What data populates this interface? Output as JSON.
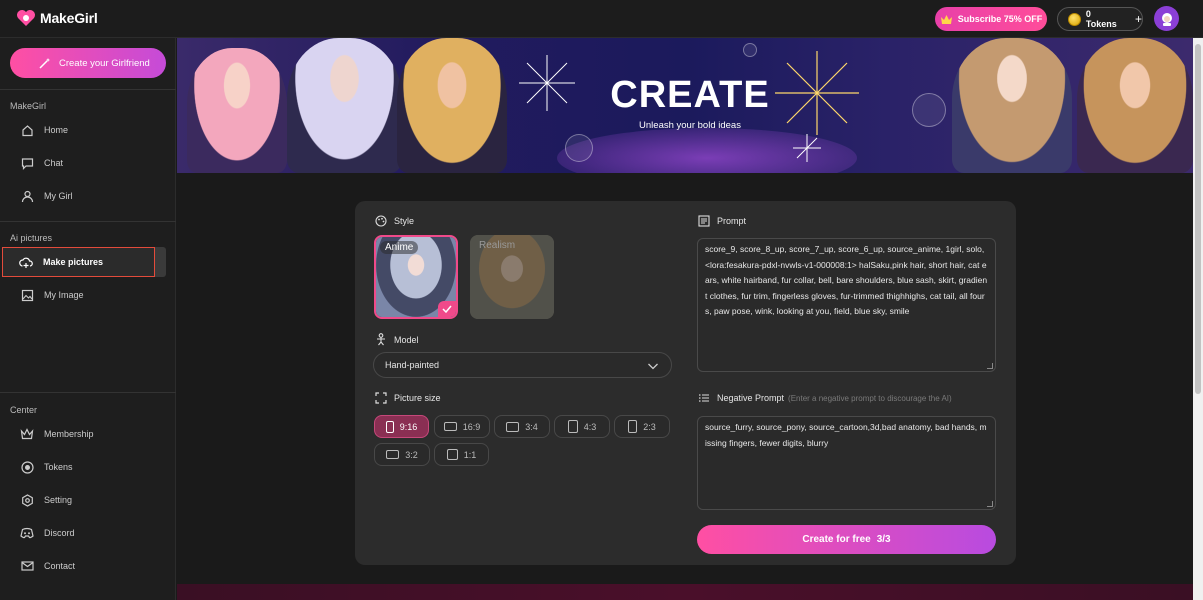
{
  "app": {
    "name_part1": "Make",
    "name_part2": "Girl"
  },
  "header": {
    "subscribe_label": "Subscribe 75% OFF",
    "tokens_label": "0 Tokens",
    "tokens_plus": "+"
  },
  "sidebar": {
    "create_button": "Create your Girlfriend",
    "sections": [
      {
        "title": "MakeGirl",
        "items": [
          "Home",
          "Chat",
          "My Girl"
        ]
      },
      {
        "title": "Ai pictures",
        "items": [
          "Make pictures",
          "My Image"
        ]
      },
      {
        "title": "Center",
        "items": [
          "Membership",
          "Tokens",
          "Setting",
          "Discord",
          "Contact"
        ]
      }
    ],
    "active_item": "Make pictures"
  },
  "banner": {
    "title": "CREATE",
    "subtitle": "Unleash your bold ideas"
  },
  "form": {
    "style_label": "Style",
    "styles": [
      {
        "name": "Anime",
        "selected": true
      },
      {
        "name": "Realism",
        "selected": false
      }
    ],
    "model_label": "Model",
    "model_value": "Hand-painted",
    "size_label": "Picture size",
    "sizes": [
      {
        "label": "9:16",
        "selected": true
      },
      {
        "label": "16:9",
        "selected": false
      },
      {
        "label": "3:4",
        "selected": false
      },
      {
        "label": "4:3",
        "selected": false
      },
      {
        "label": "2:3",
        "selected": false
      },
      {
        "label": "3:2",
        "selected": false
      },
      {
        "label": "1:1",
        "selected": false
      }
    ],
    "prompt_label": "Prompt",
    "prompt_value": "score_9, score_8_up, score_7_up, score_6_up, source_anime, 1girl, solo, <lora:fesakura-pdxl-nvwls-v1-000008:1> halSaku,pink hair, short hair, cat ears, white hairband, fur collar, bell, bare shoulders, blue sash, skirt, gradient clothes, fur trim, fingerless gloves, fur-trimmed thighhighs, cat tail, all fours, paw pose, wink, looking at you, field, blue sky, smile",
    "negative_label": "Negative Prompt",
    "negative_hint": "(Enter a negative prompt to discourage the AI)",
    "negative_value": "source_furry, source_pony, source_cartoon,3d,bad anatomy, bad hands, missing fingers, fewer digits, blurry",
    "create_label": "Create for free",
    "create_count": "3/3"
  },
  "colors": {
    "accent_pink": "#ff4fa3",
    "accent_purple": "#b84be0",
    "active_outline": "#e34b3b",
    "panel_bg": "#2c2c2c"
  }
}
